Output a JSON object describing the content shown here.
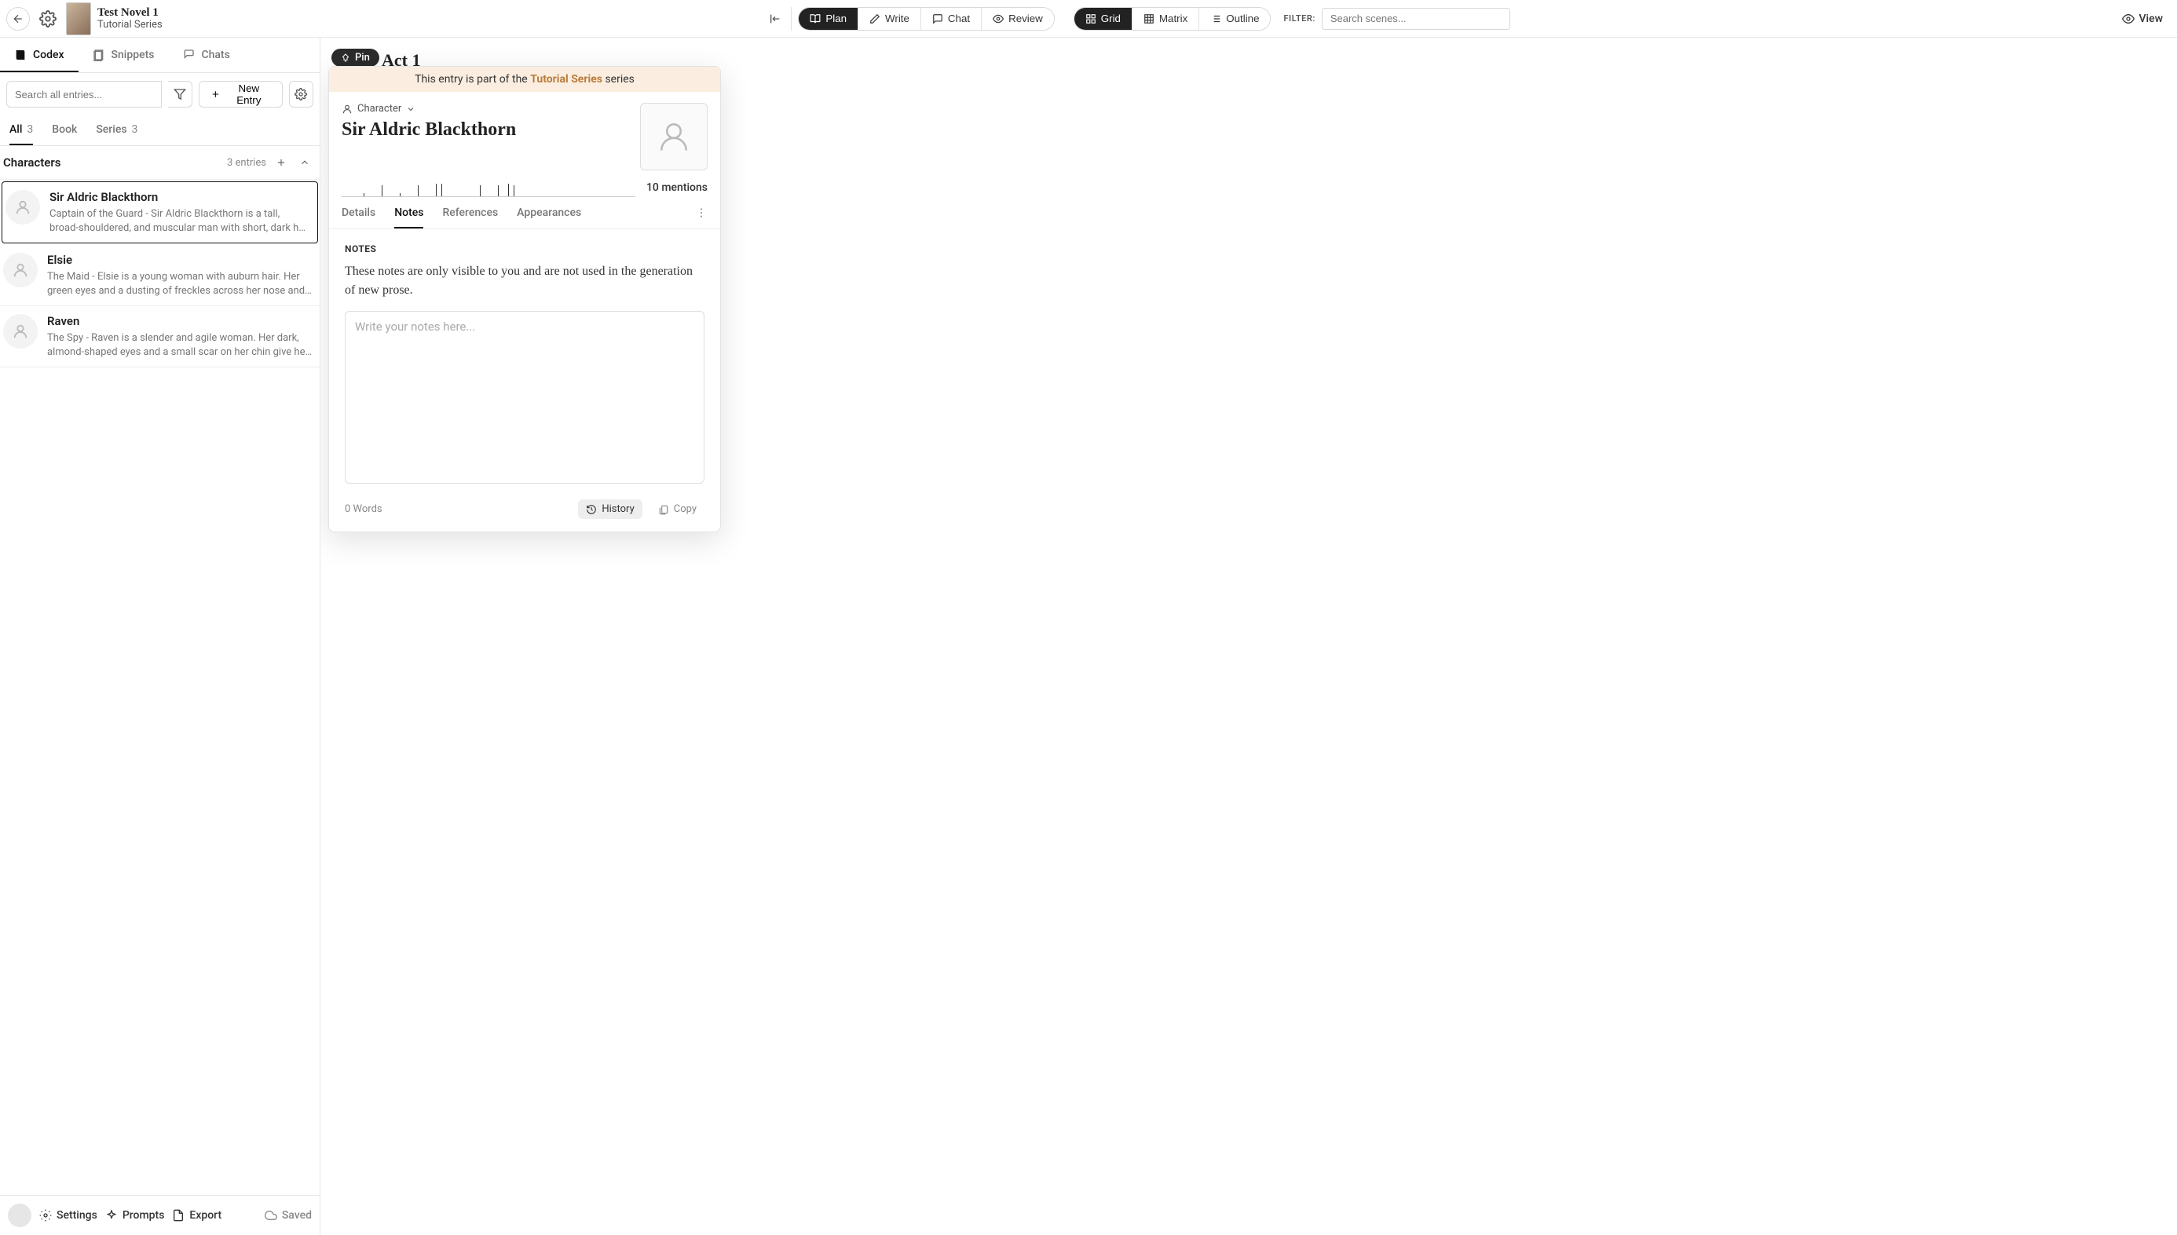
{
  "header": {
    "novel_title": "Test Novel 1",
    "series_subtitle": "Tutorial Series",
    "modes": {
      "plan": "Plan",
      "write": "Write",
      "chat": "Chat",
      "review": "Review"
    },
    "view_modes": {
      "grid": "Grid",
      "matrix": "Matrix",
      "outline": "Outline"
    },
    "filter_label": "FILTER:",
    "search_placeholder": "Search scenes...",
    "view_label": "View"
  },
  "sidebar": {
    "tabs": {
      "codex": "Codex",
      "snippets": "Snippets",
      "chats": "Chats"
    },
    "search_placeholder": "Search all entries...",
    "new_entry_label": "New Entry",
    "scope_tabs": {
      "all": {
        "label": "All",
        "count": "3"
      },
      "book": {
        "label": "Book"
      },
      "series": {
        "label": "Series",
        "count": "3"
      }
    },
    "category": {
      "name": "Characters",
      "count_label": "3 entries"
    },
    "entries": [
      {
        "name": "Sir Aldric Blackthorn",
        "desc": "Captain of the Guard - Sir Aldric Blackthorn is a tall, broad-shouldered, and muscular man with short, dark hair peppered..."
      },
      {
        "name": "Elsie",
        "desc": "The Maid - Elsie is a young woman with auburn hair. Her green eyes and a dusting of freckles across her nose and cheeks giv..."
      },
      {
        "name": "Raven",
        "desc": "The Spy - Raven is a slender and agile woman. Her dark, almond-shaped eyes and a small scar on her chin give her a..."
      }
    ],
    "footer": {
      "settings": "Settings",
      "prompts": "Prompts",
      "export": "Export",
      "saved": "Saved"
    }
  },
  "canvas": {
    "pin_label": "Pin",
    "act_label": "Act 1"
  },
  "panel": {
    "series_banner_prefix": "This entry is part of the ",
    "series_banner_name": "Tutorial Series",
    "series_banner_suffix": " series",
    "type_label": "Character",
    "title": "Sir Aldric Blackthorn",
    "mentions_label": "10 mentions",
    "tabs": {
      "details": "Details",
      "notes": "Notes",
      "references": "References",
      "appearances": "Appearances"
    },
    "section_label": "NOTES",
    "section_help": "These notes are only visible to you and are not used in the generation of new prose.",
    "notes_placeholder": "Write your notes here...",
    "word_count_label": "0 Words",
    "history_label": "History",
    "copy_label": "Copy"
  }
}
